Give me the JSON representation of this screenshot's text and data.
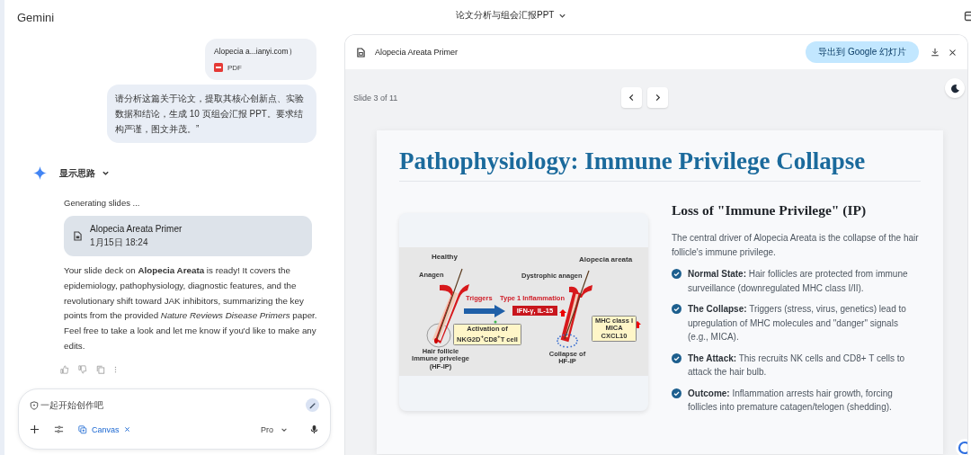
{
  "app": {
    "name": "Gemini"
  },
  "conversation": {
    "title": "论文分析与组会汇报PPT"
  },
  "chat": {
    "attachment": {
      "name": "Alopecia a...ianyi.com）",
      "type": "PDF"
    },
    "user_message": "请分析这篇关于论文，提取其核心创新点、实验数据和结论，生成 10 页组会汇报 PPT。要求结构严谨，图文并茂。”",
    "thinking": {
      "label": "显示思路",
      "expanded": false
    },
    "status": "Generating slides ...",
    "artifact": {
      "title": "Alopecia Areata Primer",
      "date": "1月15日 18:24"
    },
    "reply": "Your slide deck on **Alopecia Areata** is ready! It covers the epidemiology, pathophysiology, diagnostic features, and the revolutionary shift toward JAK inhibitors, summarizing the key points from the provided *Nature Reviews Disease Primers* paper. Feel free to take a look and let me know if you'd like to make any edits."
  },
  "composer": {
    "placeholder": "一起开始创作吧",
    "tools": [
      {
        "label": "Canvas",
        "active": true
      }
    ],
    "model": "Pro"
  },
  "canvas": {
    "title": "Alopecia Areata Primer",
    "export_button": "导出到 Google 幻灯片",
    "slide_counter": "Slide 3 of 11",
    "slide": {
      "title": "Pathophysiology: Immune Privilege Collapse",
      "heading": "Loss of \"Immune Privilege\" (IP)",
      "intro": "The central driver of Alopecia Areata is the collapse of the hair follicle's immune privilege.",
      "bullets": [
        {
          "text": "**Normal State:** Hair follicles are protected from immune surveillance (downregulated MHC class I/II)."
        },
        {
          "text": "**The Collapse:** Triggers (stress, virus, genetics) lead to upregulation of MHC molecules and \"danger\" signals (e.g., MICA)."
        },
        {
          "text": "**The Attack:** This recruits NK cells and CD8+ T cells to attack the hair bulb."
        },
        {
          "text": "**Outcome:** Inflammation arrests hair growth, forcing follicles into premature catagen/telogen (shedding)."
        }
      ],
      "figure": {
        "labels": [
          {
            "kind": "title",
            "lines": [
              "Healthy"
            ]
          },
          {
            "kind": "title",
            "lines": [
              "Alopecia areata"
            ]
          },
          {
            "kind": "note",
            "lines": [
              "Anagen"
            ]
          },
          {
            "kind": "note",
            "lines": [
              "Dystrophic anagen"
            ]
          },
          {
            "kind": "red",
            "lines": [
              "Triggers"
            ]
          },
          {
            "kind": "red",
            "lines": [
              "Type 1 Inflammation"
            ]
          },
          {
            "kind": "badge",
            "lines": [
              "IFN-γ, IL-15"
            ]
          },
          {
            "kind": "callout",
            "lines": [
              "Activation of",
              "NKG2D$^{+}$CD8$^{+}$T cell"
            ]
          },
          {
            "kind": "callout",
            "lines": [
              "MHC class I",
              "MICA",
              "CXCL10"
            ]
          },
          {
            "kind": "note",
            "lines": [
              "Hair follicle",
              "Immune privelege",
              "(HF-IP)"
            ]
          },
          {
            "kind": "note",
            "lines": [
              "Collapse of",
              "HF-IP"
            ]
          }
        ]
      }
    }
  }
}
